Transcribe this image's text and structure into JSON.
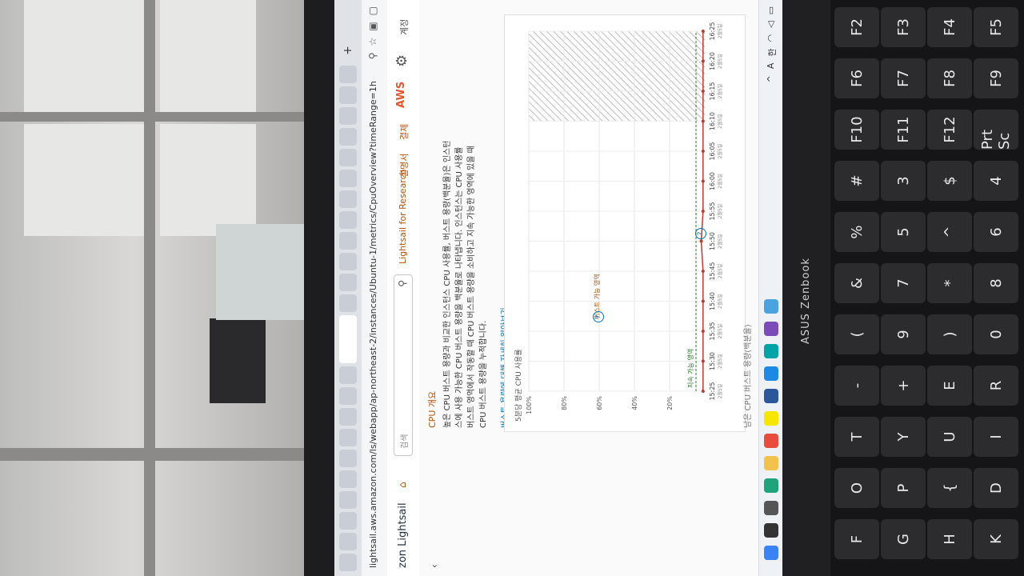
{
  "browser": {
    "url": "lightsail.aws.amazon.com/ls/webapp/ap-northeast-2/instances/Ubuntu-1/metrics/CpuOverview?timeRange=1h"
  },
  "header": {
    "brand": "zon Lightsail",
    "search_placeholder": "검색",
    "research_link": "Lightsail for Research",
    "docs_link": "설명서",
    "billing_link": "결제",
    "aws_label": "AWS",
    "account_label": "계정"
  },
  "overview": {
    "title": "CPU 개요",
    "lines": [
      "높은 CPU 버스트 용량과 비교한 인스턴스 CPU 사용률, 버스트 용량(백분율)은 인스턴",
      "스에 사용 가능한 CPU 버스트 용량을 백분율로 나타냅니다. 인스턴스는 CPU 사용률",
      "버스트 영역에서 작동할 때 CPU 버스트 용량을 소비하고 지속 가능한 영역에 있을 때",
      "CPU 버스트 용량을 누적합니다."
    ],
    "learn_more": "버스트 용량에 대해 자세히 알아보기"
  },
  "chart_panel": {
    "title": "5분당 평균 CPU 사용률",
    "burst_zone_label": "버스트 가능 영역",
    "sustainable_zone_label": "지속 가능 영역",
    "footer": "남은 CPU 버스트 용량(백분율)",
    "help": "?"
  },
  "chart_data": {
    "type": "line",
    "title": "5분당 평균 CPU 사용률",
    "x": [
      "15:25",
      "15:30",
      "15:35",
      "15:40",
      "15:45",
      "15:50",
      "15:55",
      "16:00",
      "16:05",
      "16:10",
      "16:15",
      "16:20",
      "16:25"
    ],
    "x_sub": [
      "2월5일",
      "2월5일",
      "2월5일",
      "2월5일",
      "2월5일",
      "2월5일",
      "2월5일",
      "2월5일",
      "2월5일",
      "2월5일",
      "2월5일",
      "2월5일",
      "2월5일"
    ],
    "yticks": [
      "100%",
      "80%",
      "60%",
      "40%",
      "20%"
    ],
    "ylim": [
      0,
      100
    ],
    "series": [
      {
        "values": [
          1,
          1,
          1,
          1,
          1,
          2,
          1,
          1,
          1,
          1,
          1,
          1,
          1
        ],
        "color": "#c0392b"
      }
    ],
    "sustainable_threshold": 5
  },
  "keyboard": {
    "brand": "ASUS Zenbook",
    "keys": [
      "F2",
      "F3",
      "F4",
      "F5",
      "F6",
      "F7",
      "F8",
      "F9",
      "F10",
      "F11",
      "F12",
      "Prt Sc",
      "#",
      "3",
      "$",
      "4",
      "%",
      "5",
      "^",
      "6",
      "&",
      "7",
      "*",
      "8",
      "(",
      "9",
      ")",
      "0",
      "-",
      "+",
      "E",
      "R",
      "T",
      "Y",
      "U",
      "I",
      "O",
      "P",
      "{",
      "D",
      "F",
      "G",
      "H",
      "K"
    ]
  },
  "colors": {
    "accent": "#b5520b",
    "link": "#0073bb",
    "series": "#c0392b",
    "burst_hatch": "#bdbdbd"
  }
}
